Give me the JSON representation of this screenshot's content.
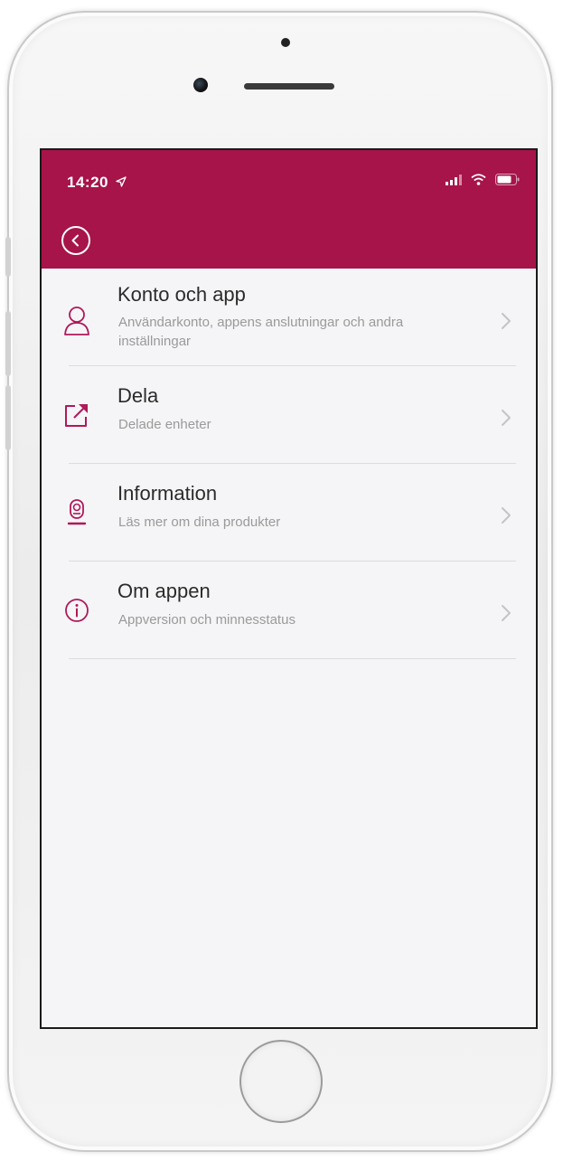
{
  "status_bar": {
    "time": "14:20",
    "location_icon": "location-arrow-icon",
    "signal_icon": "signal-icon",
    "wifi_icon": "wifi-icon",
    "battery_icon": "battery-icon"
  },
  "header": {
    "back_icon": "back-circle-icon",
    "color": "#a71449"
  },
  "accent_color": "#b0185a",
  "menu": [
    {
      "title": "Konto och app",
      "subtitle": "Användarkonto, appens anslutningar och andra inställningar",
      "icon": "user-icon"
    },
    {
      "title": "Dela",
      "subtitle": "Delade enheter",
      "icon": "share-icon"
    },
    {
      "title": "Information",
      "subtitle": "Läs mer om dina produkter",
      "icon": "device-icon"
    },
    {
      "title": "Om appen",
      "subtitle": "Appversion och minnesstatus",
      "icon": "info-icon"
    }
  ]
}
